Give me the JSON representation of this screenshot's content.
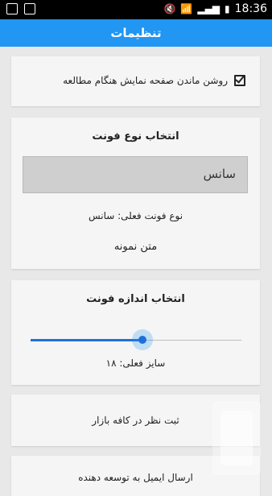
{
  "status_bar": {
    "time": "18:36"
  },
  "app_bar": {
    "title": "تنظیمات"
  },
  "keep_screen_on": {
    "label": "روشن ماندن صفحه نمایش هنگام مطالعه",
    "checked": true
  },
  "font_type": {
    "title": "انتخاب نوع فونت",
    "selected": "سانس",
    "current_label": "نوع فونت فعلی: سانس",
    "sample_text": "متن نمونه"
  },
  "font_size": {
    "title": "انتخاب اندازه فونت",
    "slider_fraction": 0.53,
    "current_label": "سایز فعلی: ۱۸"
  },
  "rate_cafebazaar": {
    "label": "ثبت نظر در کافه بازار"
  },
  "email_developer": {
    "label": "ارسال ایمیل به توسعه دهنده"
  }
}
